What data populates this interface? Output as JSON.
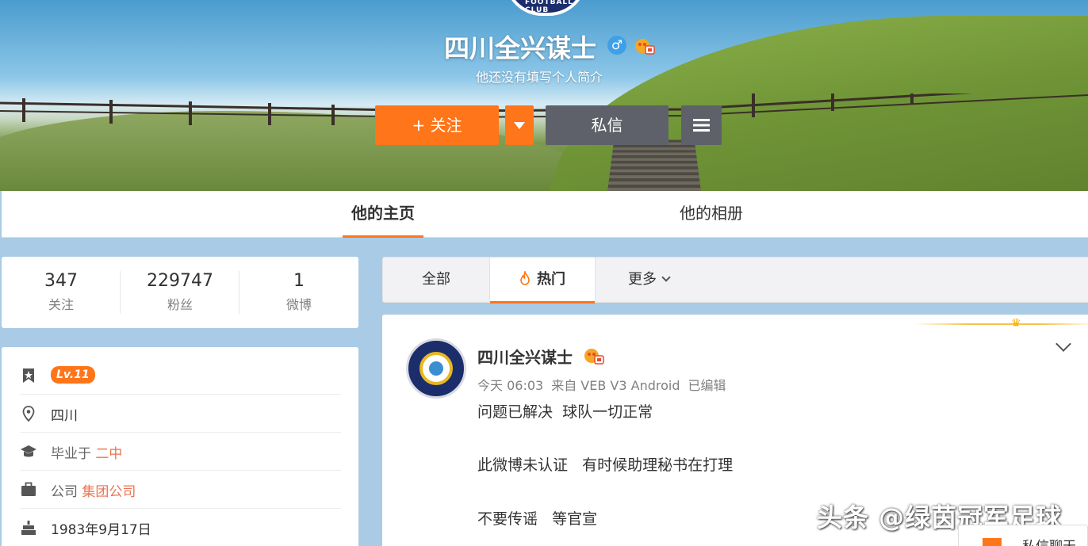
{
  "profile": {
    "name": "四川全兴谋士",
    "bio": "他还没有填写个人简介",
    "club_logo_text": "FOOTBALL CLUB",
    "follow_label": "+ 关注",
    "message_label": "私信"
  },
  "nav": {
    "tabs": [
      {
        "label": "他的主页",
        "active": true
      },
      {
        "label": "他的相册",
        "active": false
      }
    ]
  },
  "stats": [
    {
      "value": "347",
      "label": "关注"
    },
    {
      "value": "229747",
      "label": "粉丝"
    },
    {
      "value": "1",
      "label": "微博"
    }
  ],
  "info": {
    "level": "Lv.11",
    "location": "四川",
    "school_prefix": "毕业于",
    "school": "二中",
    "company_prefix": "公司",
    "company": "集团公司",
    "birthday": "1983年9月17日"
  },
  "feed_tabs": {
    "all": "全部",
    "hot": "热门",
    "more": "更多"
  },
  "post": {
    "author": "四川全兴谋士",
    "time": "今天 06:03",
    "source": "来自 VEB V3 Android",
    "edited": "已编辑",
    "lines": [
      "问题已解决  球队一切正常",
      "此微博未认证   有时候助理秘书在打理",
      "不要传谣   等官宣"
    ]
  },
  "watermark": "头条 @绿茵冠军足球",
  "chat": {
    "label": "私信聊天"
  },
  "colors": {
    "accent": "#ff7519",
    "link": "#eb7350",
    "dark_button": "#5e6169",
    "page_bg": "#a9cbe6"
  }
}
